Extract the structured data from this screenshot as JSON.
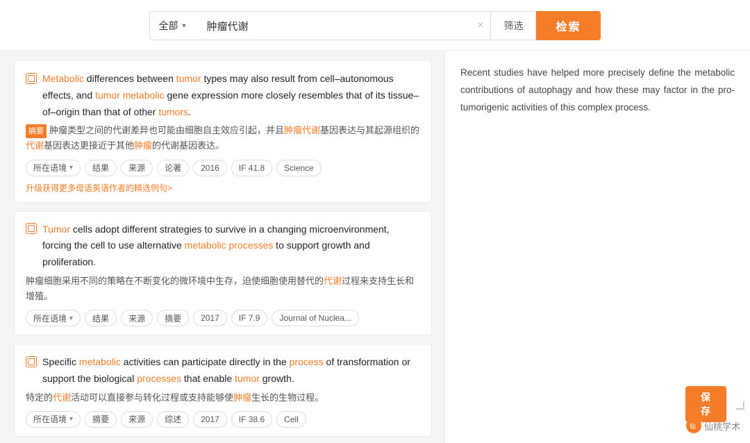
{
  "searchBar": {
    "typeLabel": "全部",
    "typeChevron": "▾",
    "inputValue": "肿瘤代谢",
    "clearLabel": "×",
    "filterLabel": "筛选",
    "searchLabel": "检索"
  },
  "results": [
    {
      "id": 1,
      "enParts": [
        {
          "text": "Metabolic",
          "highlight": true
        },
        {
          "text": " differences between ",
          "highlight": false
        },
        {
          "text": "tumor",
          "highlight": true
        },
        {
          "text": " types may also result from cell–autonomous effects, and ",
          "highlight": false
        },
        {
          "text": "tumor",
          "highlight": true
        },
        {
          "text": " ",
          "highlight": false
        },
        {
          "text": "metabolic",
          "highlight": true
        },
        {
          "text": " gene expression more closely resembles that of its tissue–of–origin than that of other ",
          "highlight": false
        },
        {
          "text": "tumors",
          "highlight": true
        },
        {
          "text": ".",
          "highlight": false
        }
      ],
      "cnBadge": "摘要",
      "cnText": "肿瘤类型之间的代谢差异也可能由细胞自主效应引起，并且",
      "cnHighlight": "肿瘤代谢",
      "cnText2": "基因表达与其起源组织的",
      "cnHighlight2": "代谢",
      "cnText3": "基因表达更接近于其他",
      "cnHighlight3": "肿瘤",
      "cnText4": "的代谢基因表达。",
      "tags": [
        "所在语境",
        "结果",
        "来源",
        "论著",
        "2016",
        "IF 41.8",
        "Science"
      ],
      "upgradeLink": "升级获得更多母语英语作者的精选例句>"
    },
    {
      "id": 2,
      "enParts": [
        {
          "text": "Tumor",
          "highlight": true
        },
        {
          "text": " cells adopt different strategies to survive in a changing microenvironment, forcing the cell to use alternative ",
          "highlight": false
        },
        {
          "text": "metabolic processes",
          "highlight": true
        },
        {
          "text": " to support growth and proliferation.",
          "highlight": false
        }
      ],
      "cnBadge": null,
      "cnText": "肿瘤细胞采用不同的策略在不断变化的微环境中生存，迫使细胞使用替代的",
      "cnHighlight": "代谢",
      "cnText2": "过程来支持生长和增殖。",
      "cnHighlight2": null,
      "cnText3": null,
      "cnHighlight3": null,
      "cnText4": null,
      "tags": [
        "所在语境",
        "结果",
        "来源",
        "摘要",
        "2017",
        "IF 7.9",
        "Journal of Nuclea..."
      ],
      "upgradeLink": null
    },
    {
      "id": 3,
      "enParts": [
        {
          "text": "Specific ",
          "highlight": false
        },
        {
          "text": "metabolic",
          "highlight": true
        },
        {
          "text": " activities can participate directly in the ",
          "highlight": false
        },
        {
          "text": "process",
          "highlight": true
        },
        {
          "text": " of transformation or support the biological ",
          "highlight": false
        },
        {
          "text": "processes",
          "highlight": true
        },
        {
          "text": " that enable ",
          "highlight": false
        },
        {
          "text": "tumor",
          "highlight": true
        },
        {
          "text": " growth.",
          "highlight": false
        }
      ],
      "cnBadge": null,
      "cnText": "特定的",
      "cnHighlight": "代谢",
      "cnText2": "活动可以直接参与转化过程或支持能够使",
      "cnHighlight2": "肿瘤",
      "cnText3": "生长的生物过程。",
      "cnHighlight3": null,
      "cnText4": null,
      "cnText5": null,
      "tags": [
        "所在语境",
        "摘要",
        "来源",
        "综述",
        "2017",
        "IF 38.6",
        "Cell"
      ],
      "upgradeLink": null
    }
  ],
  "rightPanel": {
    "text": "Recent studies have helped more precisely define the metabolic contributions of autophagy and how these may factor in the pro-tumorigenic activities of this complex process."
  },
  "footer": {
    "watermarkText": "仙桃学术",
    "saveLabel": "保存"
  }
}
